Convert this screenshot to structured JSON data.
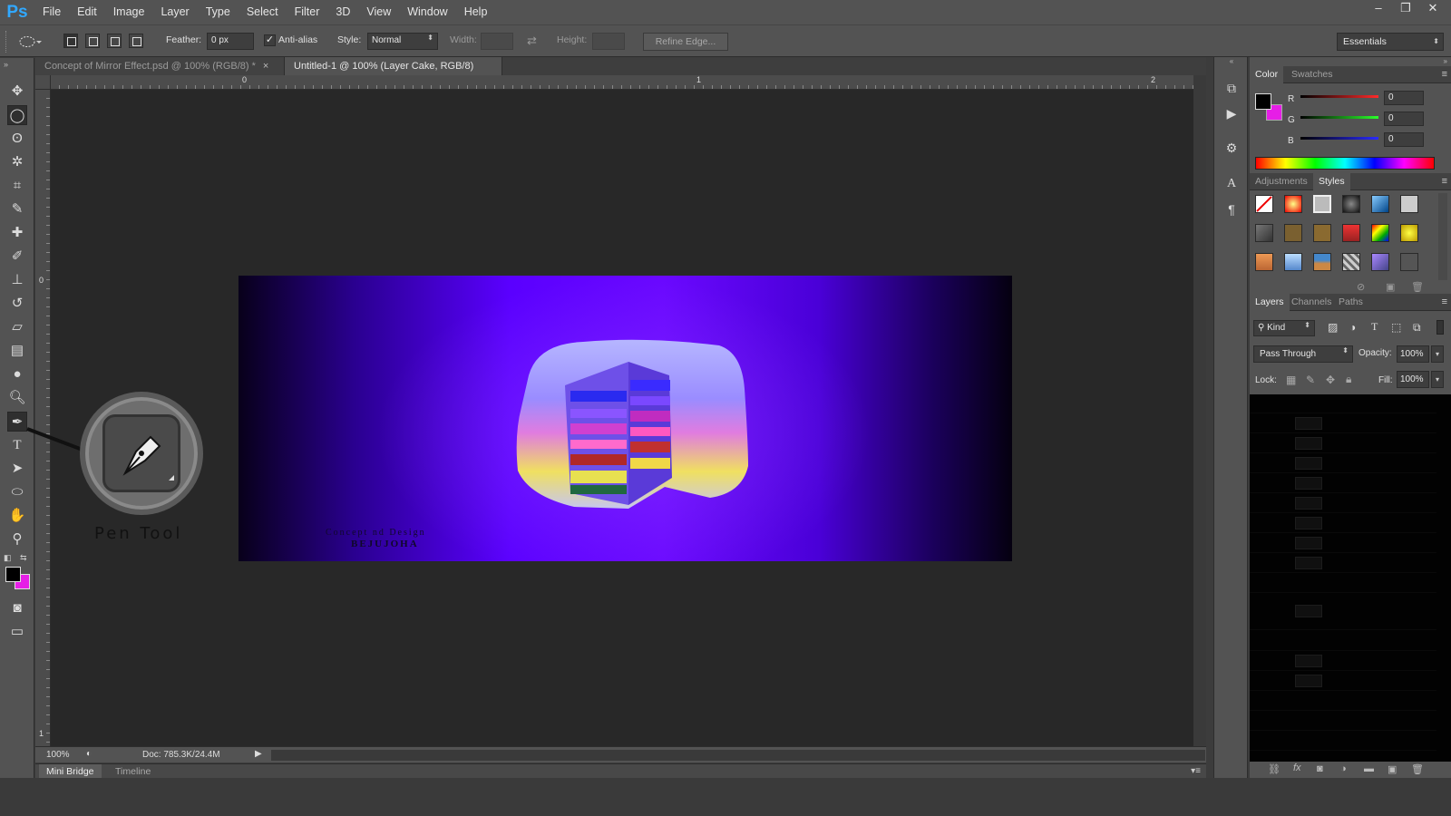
{
  "app": {
    "logo": "Ps"
  },
  "menu": [
    "File",
    "Edit",
    "Image",
    "Layer",
    "Type",
    "Select",
    "Filter",
    "3D",
    "View",
    "Window",
    "Help"
  ],
  "window_controls": [
    "–",
    "❐",
    "✕"
  ],
  "options": {
    "feather_label": "Feather:",
    "feather_value": "0 px",
    "antialias_label": "Anti-alias",
    "antialias_checked": true,
    "style_label": "Style:",
    "style_value": "Normal",
    "width_label": "Width:",
    "height_label": "Height:",
    "refine_label": "Refine Edge...",
    "workspace": "Essentials"
  },
  "doc_tabs": [
    {
      "label": "Concept of Mirror Effect.psd @ 100% (RGB/8) *",
      "close": "×"
    },
    {
      "label": "Untitled-1 @ 100% (Layer Cake, RGB/8) *",
      "close": "×"
    }
  ],
  "rulers": {
    "top_marks": [
      "0",
      "1",
      "2"
    ],
    "left_marks": [
      "0",
      "1"
    ]
  },
  "canvas": {
    "credit_line1": "Concept nd Design",
    "credit_line2": "BEJUJOHA",
    "callout_label": "Pen Tool"
  },
  "status": {
    "zoom": "100%",
    "doc": "Doc: 785.3K/24.4M"
  },
  "bottom_tabs": [
    "Mini Bridge",
    "Timeline"
  ],
  "color_panel": {
    "tabs": [
      "Color",
      "Swatches"
    ],
    "channels": [
      {
        "label": "R",
        "value": "0",
        "color": "#ff2a2a"
      },
      {
        "label": "G",
        "value": "0",
        "color": "#2aff2a"
      },
      {
        "label": "B",
        "value": "0",
        "color": "#2a2aff"
      }
    ],
    "foreground": "#000000",
    "background": "#e61ee6"
  },
  "styles_panel": {
    "tabs": [
      "Adjustments",
      "Styles"
    ]
  },
  "layers_panel": {
    "tabs": [
      "Layers",
      "Channels",
      "Paths"
    ],
    "filter_label": "Kind",
    "blend_mode": "Pass Through",
    "opacity_label": "Opacity:",
    "opacity_value": "100%",
    "lock_label": "Lock:",
    "fill_label": "Fill:",
    "fill_value": "100%"
  }
}
